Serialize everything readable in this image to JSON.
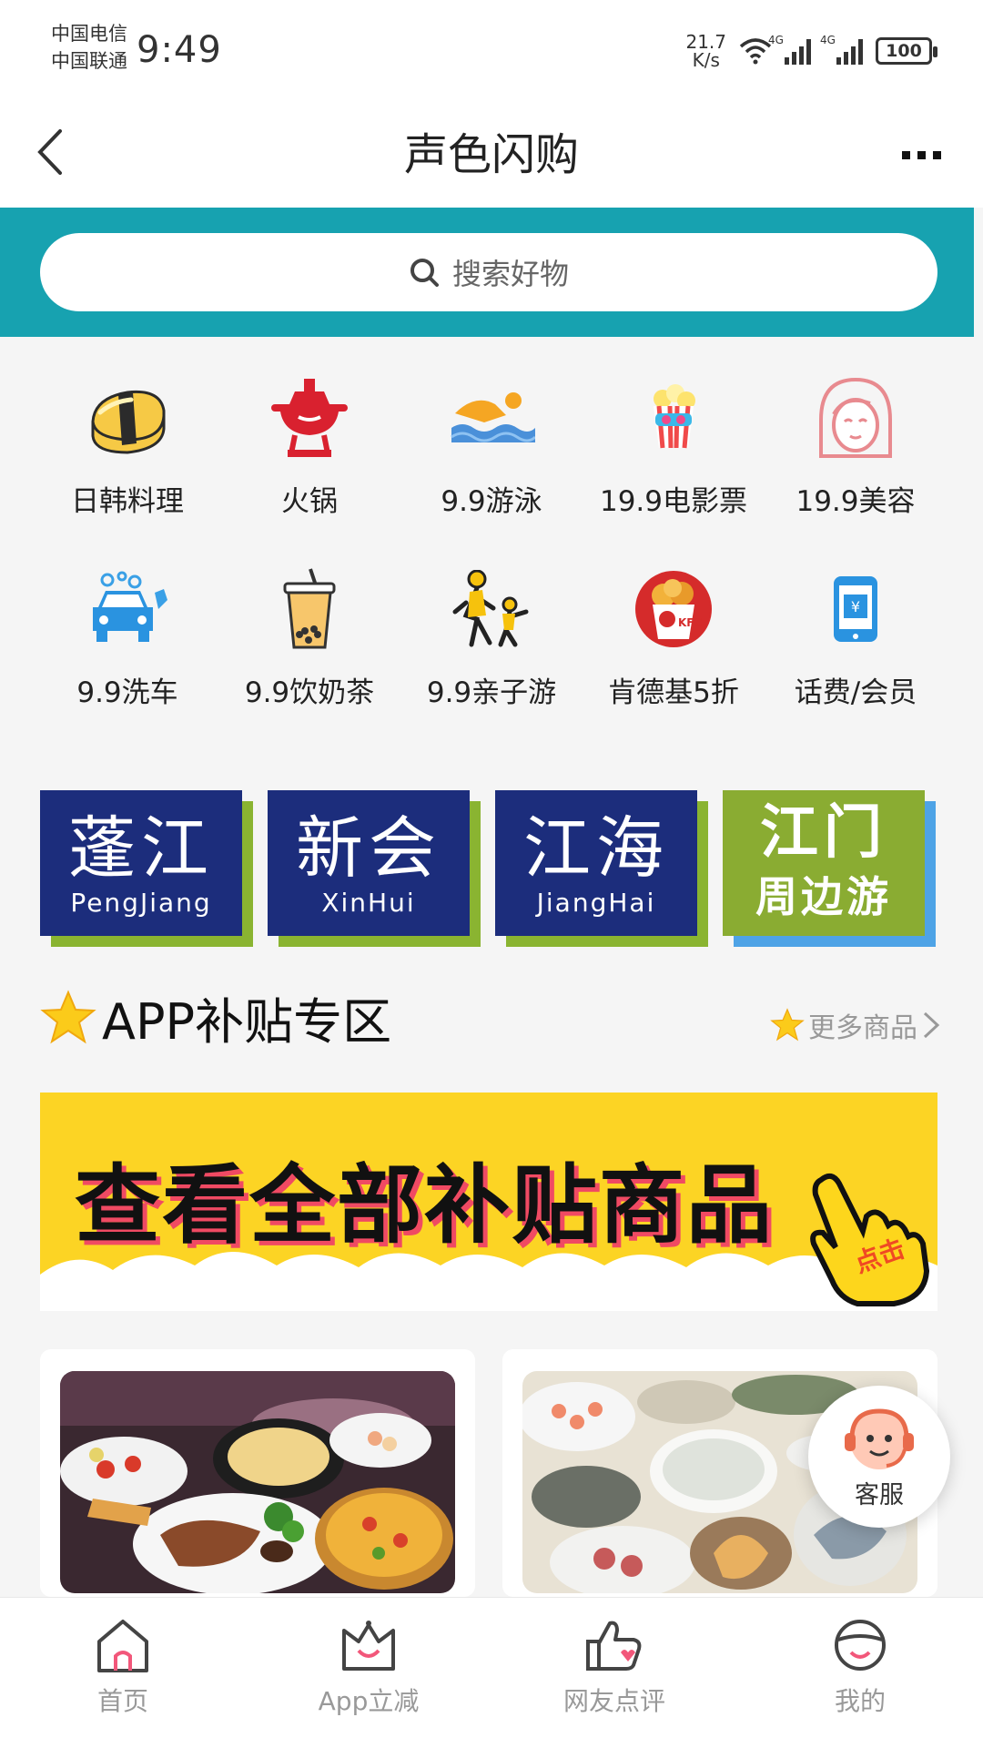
{
  "status_bar": {
    "carrier_1": "中国电信",
    "carrier_2": "中国联通",
    "time": "9:49",
    "speed_value": "21.7",
    "speed_unit": "K/s",
    "signal_1": "4G",
    "signal_2": "4G",
    "battery": "100"
  },
  "nav": {
    "title": "声色闪购"
  },
  "search": {
    "placeholder": "搜索好物"
  },
  "categories": [
    {
      "label": "日韩料理",
      "icon": "sushi-icon"
    },
    {
      "label": "火锅",
      "icon": "hotpot-icon"
    },
    {
      "label": "9.9游泳",
      "icon": "swimming-icon"
    },
    {
      "label": "19.9电影票",
      "icon": "popcorn-icon"
    },
    {
      "label": "19.9美容",
      "icon": "beauty-face-icon"
    },
    {
      "label": "9.9洗车",
      "icon": "car-wash-icon"
    },
    {
      "label": "9.9饮奶茶",
      "icon": "milk-tea-icon"
    },
    {
      "label": "9.9亲子游",
      "icon": "parent-child-icon"
    },
    {
      "label": "肯德基5折",
      "icon": "kfc-bucket-icon"
    },
    {
      "label": "话费/会员",
      "icon": "phone-bill-icon"
    }
  ],
  "cities": [
    {
      "cn": "蓬江",
      "en": "PengJiang"
    },
    {
      "cn": "新会",
      "en": "XinHui"
    },
    {
      "cn": "江海",
      "en": "JiangHai"
    },
    {
      "cn": "江门",
      "sub": "周边游"
    }
  ],
  "section": {
    "title": "APP补贴专区",
    "more": "更多商品"
  },
  "banner": {
    "text": "查看全部补贴商品",
    "hand_label": "点击"
  },
  "customer_service": {
    "label": "客服"
  },
  "tabs": [
    {
      "label": "首页",
      "icon": "home-icon"
    },
    {
      "label": "App立减",
      "icon": "crown-discount-icon"
    },
    {
      "label": "网友点评",
      "icon": "thumbs-up-icon"
    },
    {
      "label": "我的",
      "icon": "profile-icon"
    }
  ],
  "colors": {
    "search_band": "#17a2b0",
    "city_tile_blue": "#1c2d7c",
    "city_tile_green": "#8aac32",
    "banner_yellow": "#fcd424"
  }
}
